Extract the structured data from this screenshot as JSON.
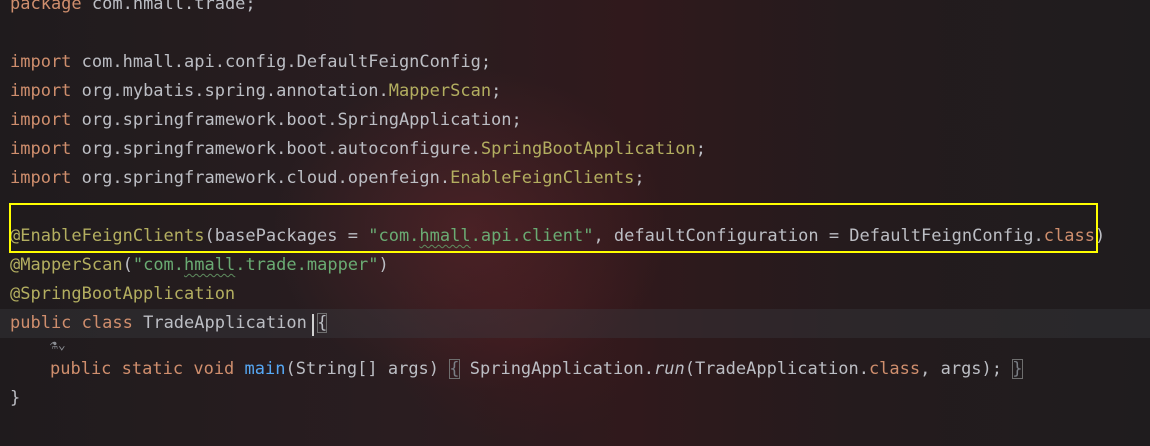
{
  "code": {
    "package_kw": "package",
    "package_name": " com.hmall.trade;",
    "imports": [
      {
        "kw": "import",
        "path": " com.hmall.api.config.DefaultFeignConfig",
        "cls": "",
        "end": ";"
      },
      {
        "kw": "import",
        "path": " org.mybatis.spring.annotation.",
        "cls": "MapperScan",
        "end": ";"
      },
      {
        "kw": "import",
        "path": " org.springframework.boot.SpringApplication",
        "cls": "",
        "end": ";"
      },
      {
        "kw": "import",
        "path": " org.springframework.boot.autoconfigure.",
        "cls": "SpringBootApplication",
        "end": ";"
      },
      {
        "kw": "import",
        "path": " org.springframework.cloud.openfeign.",
        "cls": "EnableFeignClients",
        "end": ";"
      }
    ],
    "enable_feign": {
      "annotation": "@EnableFeignClients",
      "open": "(basePackages = ",
      "str_a": "\"com.",
      "str_typo": "hmall",
      "str_b": ".api.client\"",
      "middle": ", defaultConfiguration = DefaultFeignConfig.",
      "class_kw": "class",
      "close": ")"
    },
    "mapper_scan": {
      "annotation": "@MapperScan",
      "open": "(",
      "str_a": "\"com.",
      "str_typo": "hmall",
      "str_b": ".trade.mapper\"",
      "close": ")"
    },
    "spring_boot_app": "@SpringBootApplication",
    "class_decl": {
      "kw_public": "public",
      "kw_class": "class",
      "name": " TradeApplication ",
      "brace": "{"
    },
    "gutter_hint": "⚗⌄",
    "main_method": {
      "kw_public": "public",
      "kw_static": "static",
      "kw_void": "void",
      "name": "main",
      "params": "(String[] args) ",
      "open_brace": "{",
      "body_a": " SpringApplication.",
      "run": "run",
      "body_b": "(TradeApplication.",
      "class_kw": "class",
      "body_c": ", args); ",
      "close_brace": "}"
    },
    "closing_brace": "}"
  },
  "colors": {
    "keyword": "#cf8e6d",
    "annotation": "#b3ae60",
    "string": "#6aab73",
    "method": "#56a8f5",
    "text": "#bcbec4",
    "highlight_box": "#ffff00"
  }
}
